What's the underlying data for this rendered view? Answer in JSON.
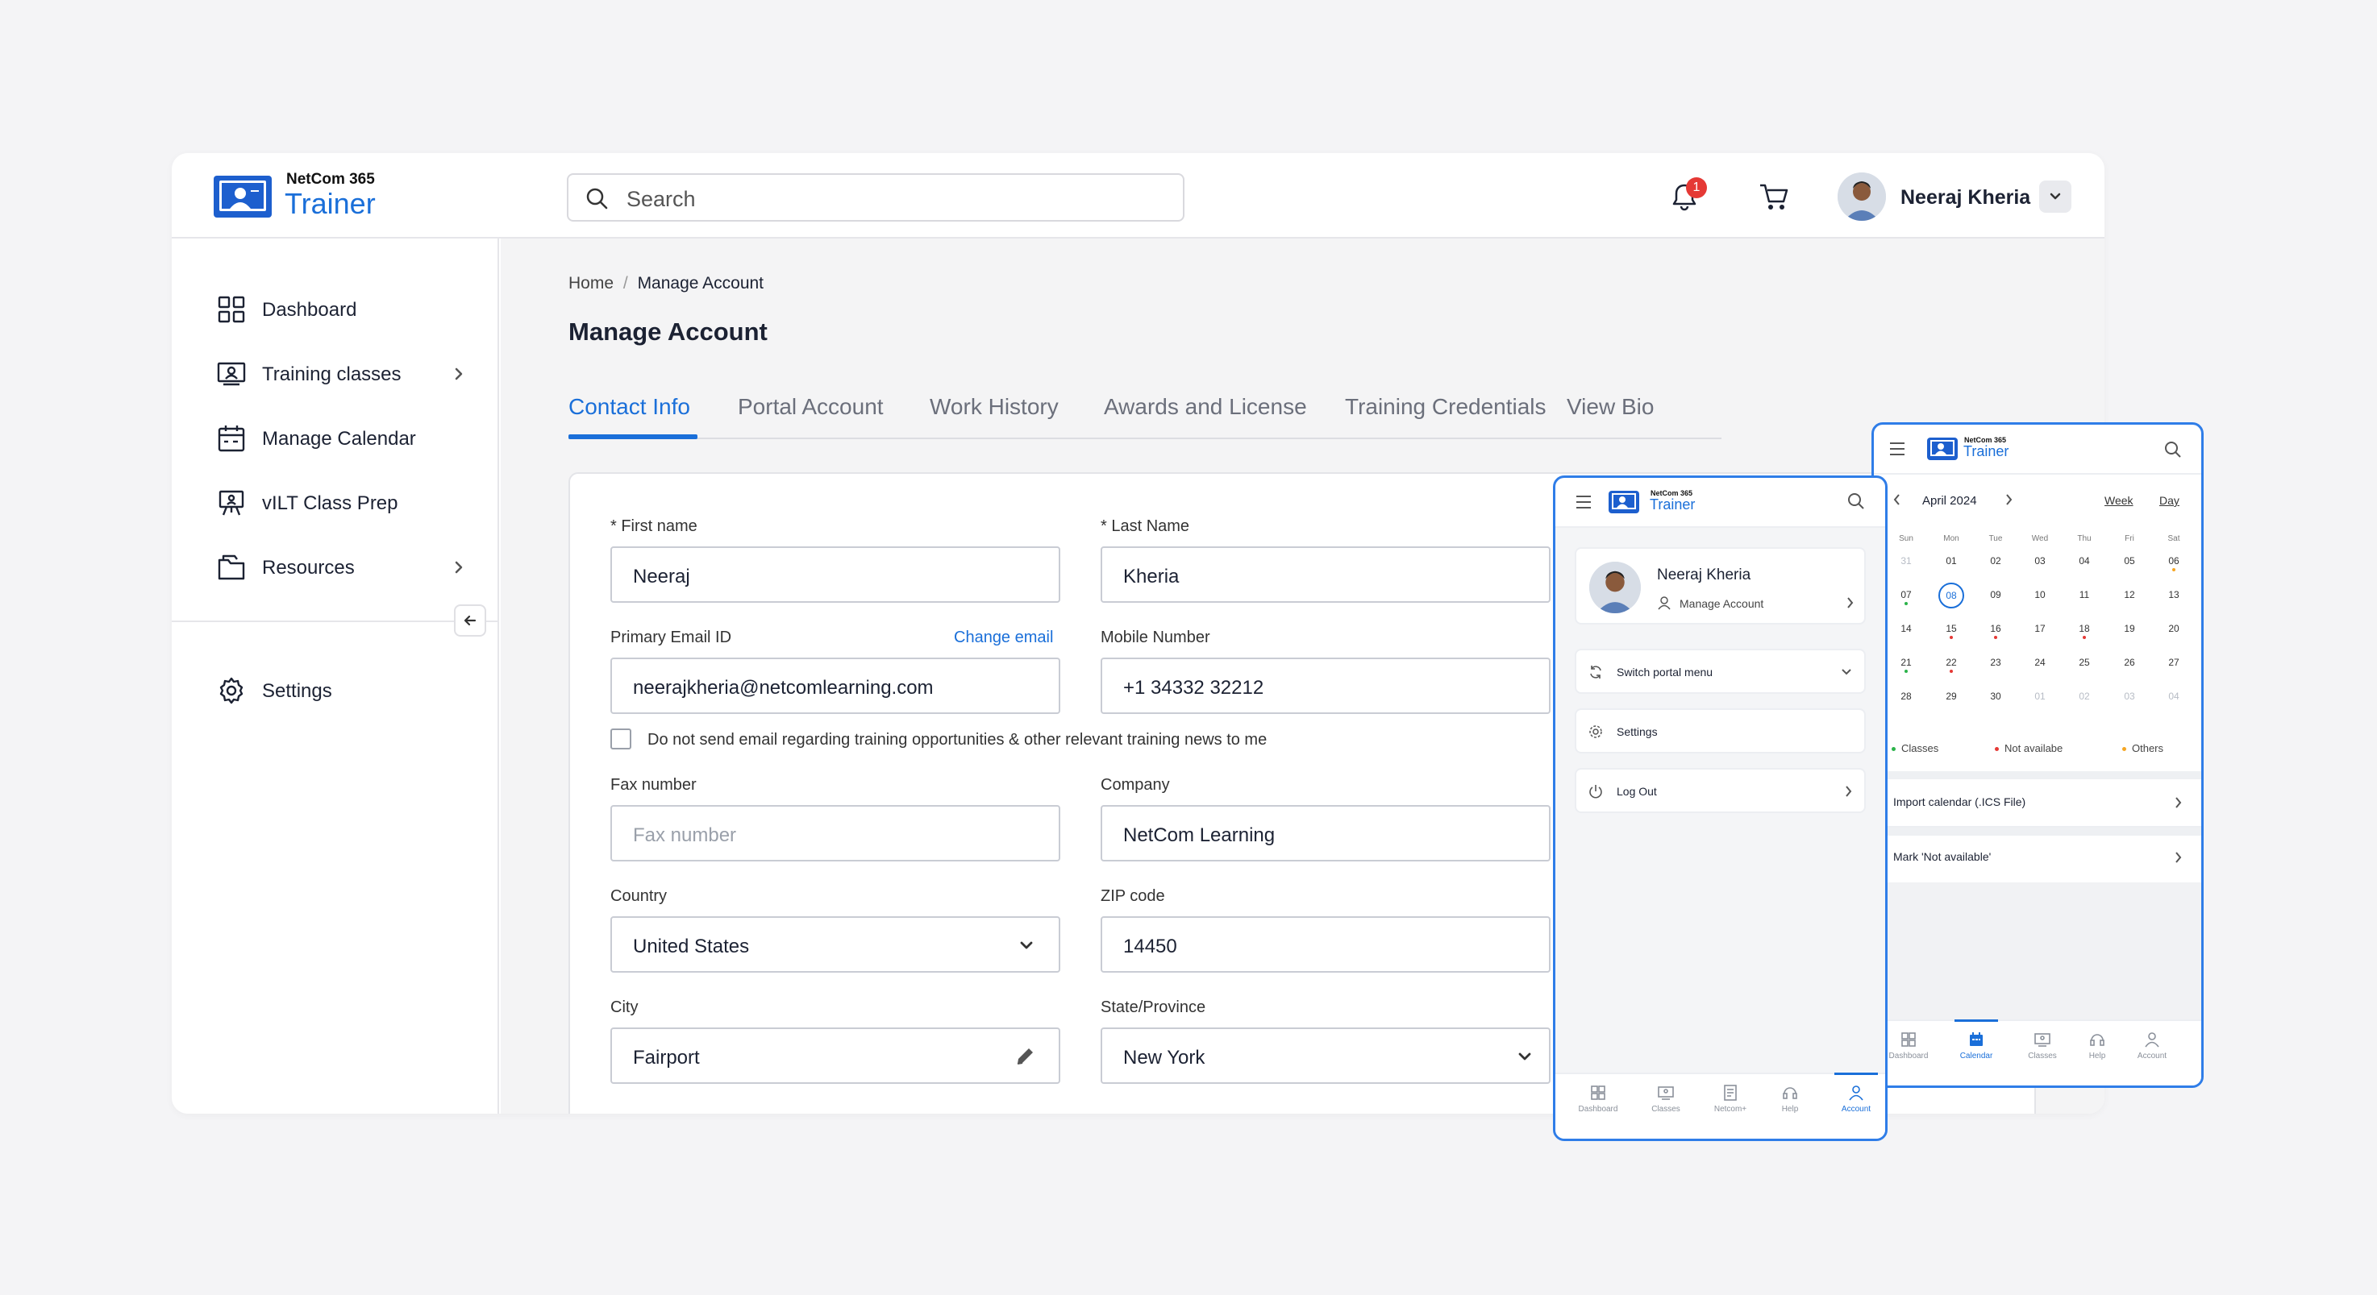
{
  "app": {
    "brand_small": "NetCom 365",
    "brand_main": "Trainer"
  },
  "header": {
    "search_placeholder": "Search",
    "notification_count": "1",
    "user_name": "Neeraj Kheria"
  },
  "sidebar": {
    "items": [
      {
        "label": "Dashboard"
      },
      {
        "label": "Training classes"
      },
      {
        "label": "Manage Calendar"
      },
      {
        "label": "vILT Class Prep"
      },
      {
        "label": "Resources"
      },
      {
        "label": "Settings"
      }
    ]
  },
  "breadcrumb": {
    "home": "Home",
    "separator": "/",
    "current": "Manage Account"
  },
  "page": {
    "title": "Manage Account"
  },
  "tabs": [
    "Contact Info",
    "Portal Account",
    "Work History",
    "Awards and License",
    "Training Credentials",
    "View Bio"
  ],
  "form": {
    "first_name": {
      "label": "* First name",
      "value": "Neeraj"
    },
    "last_name": {
      "label": "* Last Name",
      "value": "Kheria"
    },
    "email": {
      "label": "Primary Email ID",
      "link": "Change email",
      "value": "neerajkheria@netcomlearning.com"
    },
    "mobile": {
      "label": "Mobile Number",
      "value": "+1 34332 32212"
    },
    "optout": {
      "label": "Do not send email regarding training opportunities & other relevant training news to me",
      "checked": false
    },
    "fax": {
      "label": "Fax number",
      "placeholder": "Fax number"
    },
    "company": {
      "label": "Company",
      "value": "NetCom Learning"
    },
    "country": {
      "label": "Country",
      "value": "United States"
    },
    "zip": {
      "label": "ZIP code",
      "value": "14450"
    },
    "city": {
      "label": "City",
      "value": "Fairport"
    },
    "state": {
      "label": "State/Province",
      "value": "New York"
    }
  },
  "mobile_account": {
    "brand_small": "NetCom 365",
    "brand_main": "Trainer",
    "profile_name": "Neeraj Kheria",
    "profile_link": "Manage Account",
    "menu": [
      "Switch portal menu",
      "Settings",
      "Log Out"
    ],
    "bottom_nav": [
      "Dashboard",
      "Classes",
      "Netcom+",
      "Help",
      "Account"
    ],
    "active_nav": "Account"
  },
  "mobile_calendar": {
    "brand_small": "NetCom 365",
    "brand_main": "Trainer",
    "month": "April 2024",
    "views": [
      "Week",
      "Day"
    ],
    "weekdays": [
      "Sun",
      "Mon",
      "Tue",
      "Wed",
      "Thu",
      "Fri",
      "Sat"
    ],
    "days": [
      [
        "31",
        "01",
        "02",
        "03",
        "04",
        "05",
        "06"
      ],
      [
        "07",
        "08",
        "09",
        "10",
        "11",
        "12",
        "13"
      ],
      [
        "14",
        "15",
        "16",
        "17",
        "18",
        "19",
        "20"
      ],
      [
        "21",
        "22",
        "23",
        "24",
        "25",
        "26",
        "27"
      ],
      [
        "28",
        "29",
        "30",
        "01",
        "02",
        "03",
        "04"
      ]
    ],
    "selected_day": "08",
    "legend": [
      {
        "label": "Classes",
        "color": "#2bb34a"
      },
      {
        "label": "Not availabe",
        "color": "#e53935"
      },
      {
        "label": "Others",
        "color": "#f5a623"
      }
    ],
    "actions": [
      "Import calendar (.ICS File)",
      "Mark 'Not available'"
    ],
    "bottom_nav": [
      "Dashboard",
      "Calendar",
      "Classes",
      "Help",
      "Account"
    ],
    "active_nav": "Calendar"
  },
  "colors": {
    "accent": "#1a6fd9",
    "badge": "#e53935",
    "sidebar_bg": "#ffffff",
    "content_bg": "#f4f4f5"
  }
}
